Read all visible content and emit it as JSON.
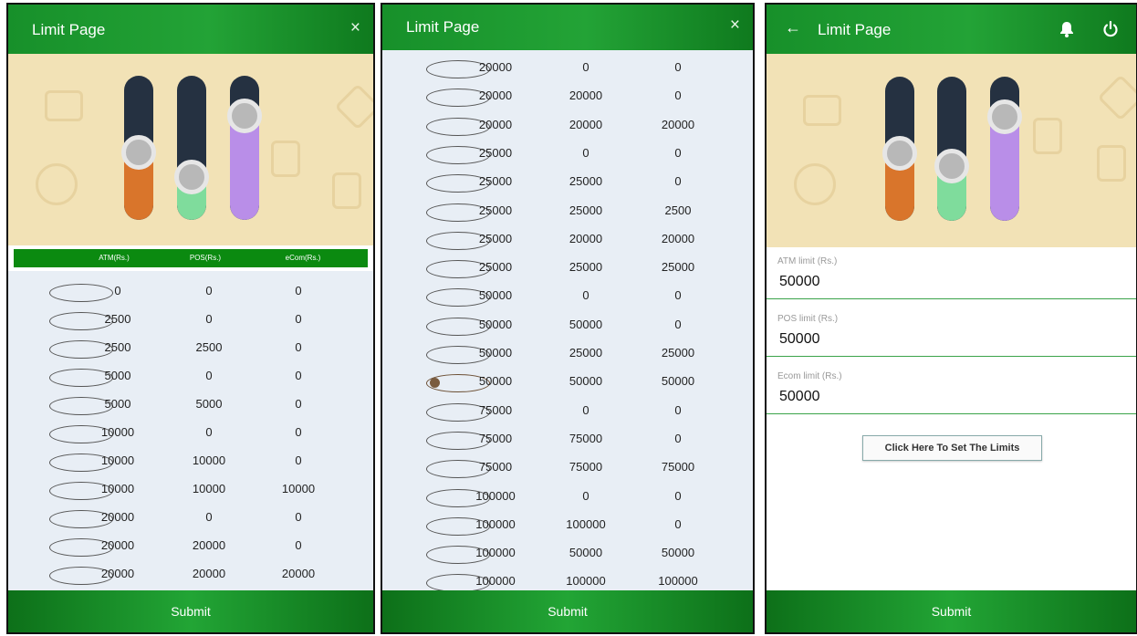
{
  "panel1": {
    "title": "Limit Page",
    "close_icon": "×",
    "columns": [
      "ATM(Rs.)",
      "POS(Rs.)",
      "eCom(Rs.)"
    ],
    "rows": [
      [
        "0",
        "0",
        "0"
      ],
      [
        "2500",
        "0",
        "0"
      ],
      [
        "2500",
        "2500",
        "0"
      ],
      [
        "5000",
        "0",
        "0"
      ],
      [
        "5000",
        "5000",
        "0"
      ],
      [
        "10000",
        "0",
        "0"
      ],
      [
        "10000",
        "10000",
        "0"
      ],
      [
        "10000",
        "10000",
        "10000"
      ],
      [
        "20000",
        "0",
        "0"
      ],
      [
        "20000",
        "20000",
        "0"
      ],
      [
        "20000",
        "20000",
        "20000"
      ]
    ],
    "submit": "Submit"
  },
  "panel2": {
    "title": "Limit Page",
    "close_icon": "×",
    "selected_index": 11,
    "rows": [
      [
        "20000",
        "0",
        "0"
      ],
      [
        "20000",
        "20000",
        "0"
      ],
      [
        "20000",
        "20000",
        "20000"
      ],
      [
        "25000",
        "0",
        "0"
      ],
      [
        "25000",
        "25000",
        "0"
      ],
      [
        "25000",
        "25000",
        "2500"
      ],
      [
        "25000",
        "20000",
        "20000"
      ],
      [
        "25000",
        "25000",
        "25000"
      ],
      [
        "50000",
        "0",
        "0"
      ],
      [
        "50000",
        "50000",
        "0"
      ],
      [
        "50000",
        "25000",
        "25000"
      ],
      [
        "50000",
        "50000",
        "50000"
      ],
      [
        "75000",
        "0",
        "0"
      ],
      [
        "75000",
        "75000",
        "0"
      ],
      [
        "75000",
        "75000",
        "75000"
      ],
      [
        "100000",
        "0",
        "0"
      ],
      [
        "100000",
        "100000",
        "0"
      ],
      [
        "100000",
        "50000",
        "50000"
      ],
      [
        "100000",
        "100000",
        "100000"
      ]
    ],
    "submit": "Submit"
  },
  "panel3": {
    "title": "Limit Page",
    "back_icon": "←",
    "bell_icon": "bell-icon",
    "power_icon": "power-icon",
    "atm_label": "ATM limit (Rs.)",
    "atm_value": "50000",
    "pos_label": "POS limit (Rs.)",
    "pos_value": "50000",
    "ecom_label": "Ecom limit (Rs.)",
    "ecom_value": "50000",
    "set_button": "Click Here To Set The Limits",
    "submit": "Submit"
  },
  "sliders": {
    "atm_color": "#d9752b",
    "pos_color": "#7fdc9c",
    "ecom_color": "#b98ee8",
    "track_color": "#253141",
    "panel1_levels": [
      0.47,
      0.3,
      0.72
    ],
    "panel3_levels": [
      0.47,
      0.38,
      0.72
    ]
  },
  "colors": {
    "header_green": "#1e9a32",
    "list_bg": "#e8eef5",
    "banner_bg": "#f2e2b6"
  }
}
